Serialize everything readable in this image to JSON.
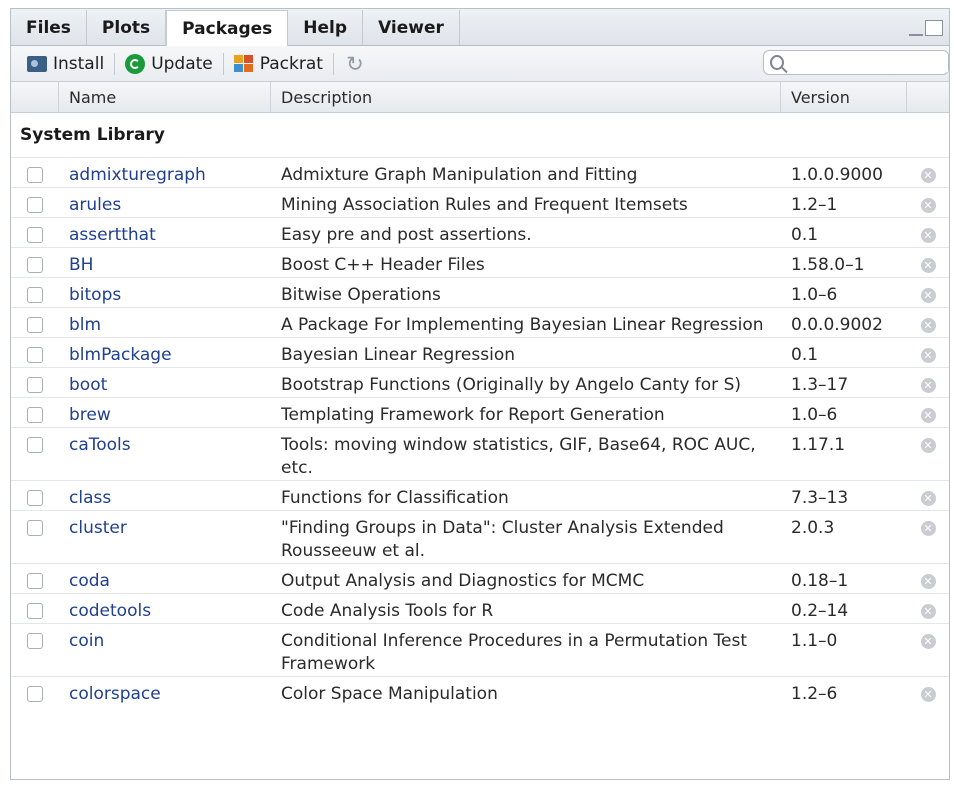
{
  "tabs": [
    {
      "label": "Files",
      "active": false
    },
    {
      "label": "Plots",
      "active": false
    },
    {
      "label": "Packages",
      "active": true
    },
    {
      "label": "Help",
      "active": false
    },
    {
      "label": "Viewer",
      "active": false
    }
  ],
  "toolbar": {
    "install_label": "Install",
    "update_label": "Update",
    "packrat_label": "Packrat",
    "search_placeholder": ""
  },
  "columns": {
    "name": "Name",
    "description": "Description",
    "version": "Version"
  },
  "section_title": "System Library",
  "packages": [
    {
      "name": "admixturegraph",
      "description": "Admixture Graph Manipulation and Fitting",
      "version": "1.0.0.9000"
    },
    {
      "name": "arules",
      "description": "Mining Association Rules and Frequent Itemsets",
      "version": "1.2–1"
    },
    {
      "name": "assertthat",
      "description": "Easy pre and post assertions.",
      "version": "0.1"
    },
    {
      "name": "BH",
      "description": "Boost C++ Header Files",
      "version": "1.58.0–1"
    },
    {
      "name": "bitops",
      "description": "Bitwise Operations",
      "version": "1.0–6"
    },
    {
      "name": "blm",
      "description": "A Package For Implementing Bayesian Linear Regression",
      "version": "0.0.0.9002"
    },
    {
      "name": "blmPackage",
      "description": "Bayesian Linear Regression",
      "version": "0.1"
    },
    {
      "name": "boot",
      "description": "Bootstrap Functions (Originally by Angelo Canty for S)",
      "version": "1.3–17"
    },
    {
      "name": "brew",
      "description": "Templating Framework for Report Generation",
      "version": "1.0–6"
    },
    {
      "name": "caTools",
      "description": "Tools: moving window statistics, GIF, Base64, ROC AUC, etc.",
      "version": "1.17.1"
    },
    {
      "name": "class",
      "description": "Functions for Classification",
      "version": "7.3–13"
    },
    {
      "name": "cluster",
      "description": "\"Finding Groups in Data\": Cluster Analysis Extended Rousseeuw et al.",
      "version": "2.0.3"
    },
    {
      "name": "coda",
      "description": "Output Analysis and Diagnostics for MCMC",
      "version": "0.18–1"
    },
    {
      "name": "codetools",
      "description": "Code Analysis Tools for R",
      "version": "0.2–14"
    },
    {
      "name": "coin",
      "description": "Conditional Inference Procedures in a Permutation Test Framework",
      "version": "1.1–0"
    },
    {
      "name": "colorspace",
      "description": "Color Space Manipulation",
      "version": "1.2–6"
    }
  ],
  "colors": {
    "link": "#1f3f8f",
    "update_icon": "#1a9a3a",
    "install_icon": "#3c5f86"
  },
  "icons": {
    "install": "install-icon",
    "update": "update-icon",
    "packrat": "packrat-icon",
    "refresh": "refresh-icon",
    "search": "search-icon",
    "remove": "remove-icon"
  }
}
